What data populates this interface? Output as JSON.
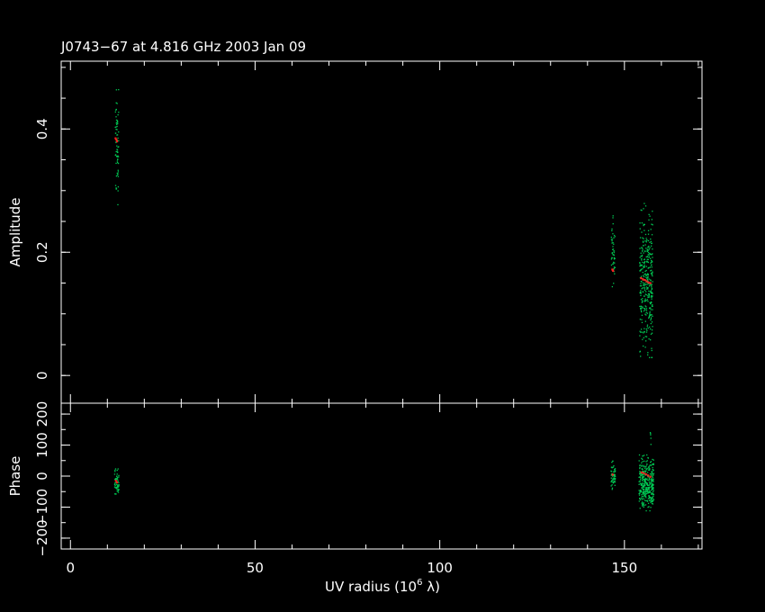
{
  "chart_data": {
    "type": "scatter",
    "title": "J0743−67 at 4.816 GHz 2003 Jan 09",
    "xlabel": "UV radius  (10",
    "xlabel_exp": "6",
    "xlabel_unit": " λ)",
    "xlim": [
      -2.5,
      171
    ],
    "x_ticks": [
      0,
      50,
      100,
      150
    ],
    "grid": false,
    "colors": {
      "background": "#000000",
      "axes": "#ffffff",
      "data": "#00c853",
      "model": "#ff2020"
    },
    "panels": [
      {
        "id": "amplitude",
        "ylabel": "Amplitude",
        "ylim": [
          -0.045,
          0.51
        ],
        "y_ticks": [
          0,
          0.2,
          0.4
        ],
        "y_tick_labels": [
          "0",
          "0.2",
          "0.4"
        ],
        "clusters": [
          {
            "x_min": 12.0,
            "x_max": 12.9,
            "y_min": 0.275,
            "y_max": 0.465,
            "n": 70
          },
          {
            "x_min": 146.3,
            "x_max": 147.3,
            "y_min": 0.145,
            "y_max": 0.26,
            "n": 50
          },
          {
            "x_min": 154.0,
            "x_max": 157.5,
            "y_min": 0.03,
            "y_max": 0.28,
            "n": 360
          }
        ],
        "model": [
          {
            "x": 12.2,
            "y": 0.385
          },
          {
            "x": 12.4,
            "y": 0.383
          },
          {
            "x": 12.6,
            "y": 0.38
          },
          {
            "x": 146.7,
            "y": 0.172
          },
          {
            "x": 146.9,
            "y": 0.17
          },
          {
            "x": 154.5,
            "y": 0.158
          },
          {
            "x": 155.0,
            "y": 0.156
          },
          {
            "x": 155.5,
            "y": 0.155
          },
          {
            "x": 156.0,
            "y": 0.153
          },
          {
            "x": 156.5,
            "y": 0.151
          },
          {
            "x": 157.0,
            "y": 0.15
          }
        ]
      },
      {
        "id": "phase",
        "ylabel": "Phase",
        "ylim": [
          -235,
          235
        ],
        "y_ticks": [
          -200,
          -100,
          0,
          100,
          200
        ],
        "y_tick_labels": [
          "−200",
          "−100",
          "0",
          "100",
          "200"
        ],
        "clusters": [
          {
            "x_min": 11.8,
            "x_max": 13.0,
            "y_min": -75,
            "y_max": 25,
            "n": 60
          },
          {
            "x_min": 146.2,
            "x_max": 147.4,
            "y_min": -45,
            "y_max": 50,
            "n": 60
          },
          {
            "x_min": 153.8,
            "x_max": 157.8,
            "y_min": -110,
            "y_max": 70,
            "n": 360
          },
          {
            "x_min": 156.8,
            "x_max": 157.2,
            "y_min": 100,
            "y_max": 170,
            "n": 5
          }
        ],
        "model": [
          {
            "x": 12.3,
            "y": -15
          },
          {
            "x": 12.6,
            "y": -20
          },
          {
            "x": 146.8,
            "y": 5
          },
          {
            "x": 154.6,
            "y": 12
          },
          {
            "x": 155.2,
            "y": 10
          },
          {
            "x": 155.8,
            "y": 6
          },
          {
            "x": 156.4,
            "y": 2
          },
          {
            "x": 157.0,
            "y": -2
          }
        ]
      }
    ]
  }
}
